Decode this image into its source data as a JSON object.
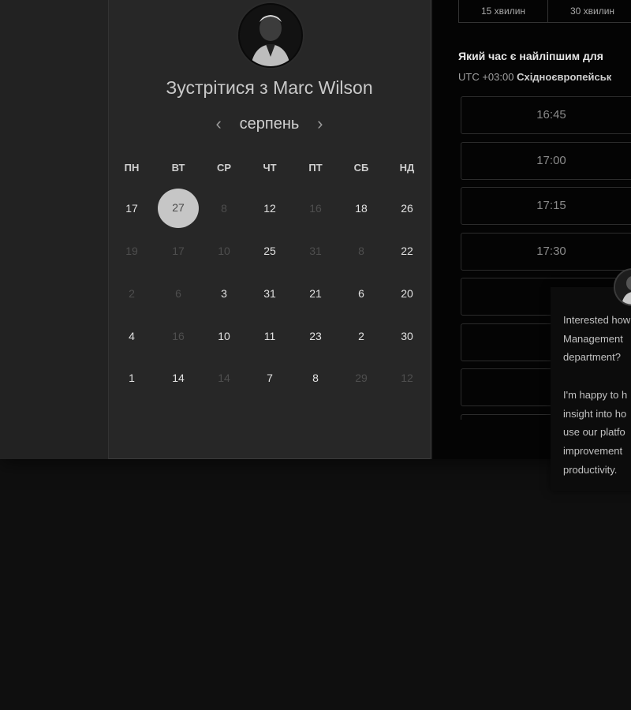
{
  "booking": {
    "title": "Зустрітися з Marc Wilson",
    "month": "серпень",
    "prev_icon": "chevron-left-icon",
    "next_icon": "chevron-right-icon",
    "weekdays": [
      "ПН",
      "ВТ",
      "СР",
      "ЧТ",
      "ПТ",
      "СБ",
      "НД"
    ],
    "weeks": [
      [
        {
          "d": "17",
          "m": false
        },
        {
          "d": "27",
          "m": false,
          "sel": true
        },
        {
          "d": "8",
          "m": true
        },
        {
          "d": "12",
          "m": false
        },
        {
          "d": "16",
          "m": true
        },
        {
          "d": "18",
          "m": false
        },
        {
          "d": "26",
          "m": false
        }
      ],
      [
        {
          "d": "19",
          "m": true
        },
        {
          "d": "17",
          "m": true
        },
        {
          "d": "10",
          "m": true
        },
        {
          "d": "25",
          "m": false
        },
        {
          "d": "31",
          "m": true
        },
        {
          "d": "8",
          "m": true
        },
        {
          "d": "22",
          "m": false
        }
      ],
      [
        {
          "d": "2",
          "m": true
        },
        {
          "d": "6",
          "m": true
        },
        {
          "d": "3",
          "m": false
        },
        {
          "d": "31",
          "m": false
        },
        {
          "d": "21",
          "m": false
        },
        {
          "d": "6",
          "m": false
        },
        {
          "d": "20",
          "m": false
        }
      ],
      [
        {
          "d": "4",
          "m": false
        },
        {
          "d": "16",
          "m": true
        },
        {
          "d": "10",
          "m": false
        },
        {
          "d": "11",
          "m": false
        },
        {
          "d": "23",
          "m": false
        },
        {
          "d": "2",
          "m": false
        },
        {
          "d": "30",
          "m": false
        }
      ],
      [
        {
          "d": "1",
          "m": false
        },
        {
          "d": "14",
          "m": false
        },
        {
          "d": "14",
          "m": true
        },
        {
          "d": "7",
          "m": false
        },
        {
          "d": "8",
          "m": false
        },
        {
          "d": "29",
          "m": true
        },
        {
          "d": "12",
          "m": true
        }
      ]
    ]
  },
  "duration_tabs": [
    "15 хвилин",
    "30 хвилин"
  ],
  "question": "Який час є найліпшим для",
  "timezone": {
    "offset": "UTC +03:00",
    "name": "Східноєвропейськ"
  },
  "time_slots": [
    "16:45",
    "17:00",
    "17:15",
    "17:30",
    "",
    "",
    "",
    ""
  ],
  "chat": {
    "text": "Interested how\nManagement\ndepartment?\n\nI'm happy to h\ninsight into ho\nuse our platfo\nimprovement\nproductivity."
  },
  "colors": {
    "selected_day": "#c6c6c6",
    "background": "#0f0f0f",
    "panel": "#272727"
  }
}
